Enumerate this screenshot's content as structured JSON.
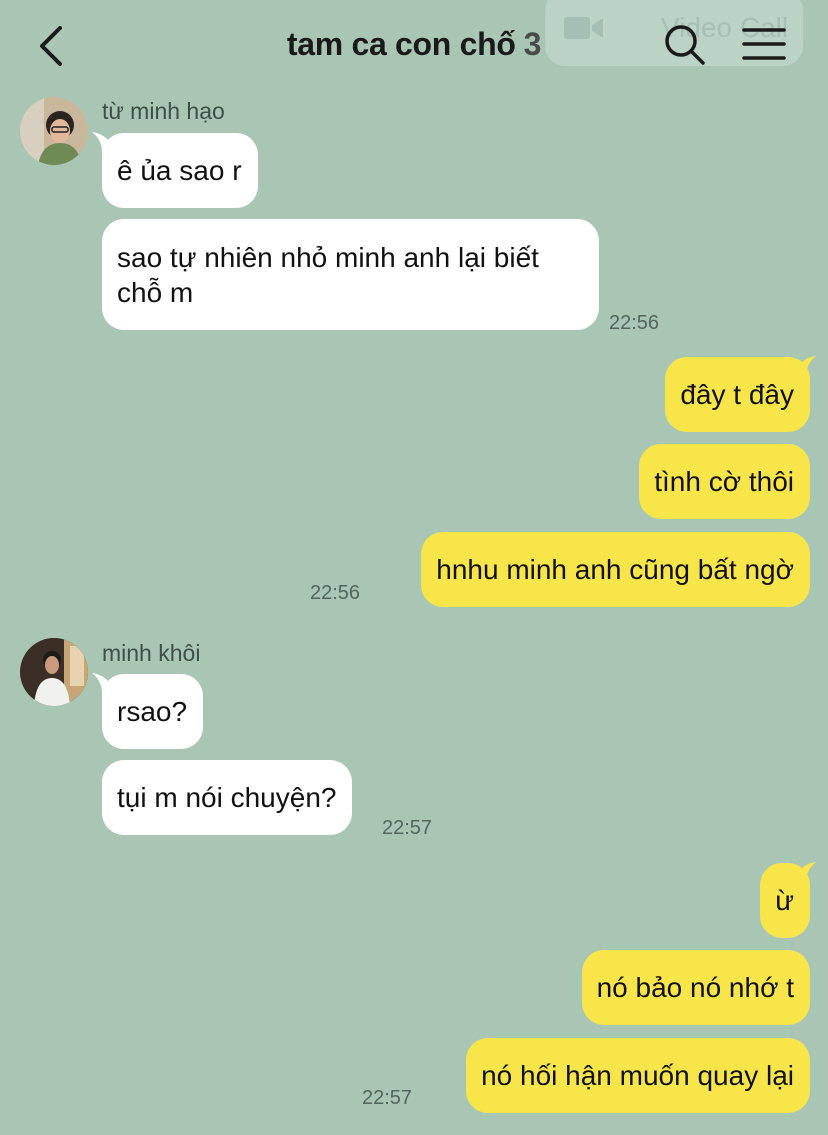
{
  "header": {
    "title": "tam ca con chố",
    "member_count": "3",
    "video_call_label": "Video Call"
  },
  "groups": [
    {
      "sender": "từ minh hạo",
      "messages": [
        "ê ủa sao r",
        "sao tự nhiên nhỏ minh anh lại biết chỗ m"
      ],
      "time": "22:56"
    },
    {
      "sender": "me",
      "messages": [
        "đây t đây",
        "tình cờ thôi",
        "hnhu minh anh cũng bất ngờ"
      ],
      "time": "22:56"
    },
    {
      "sender": "minh khôi",
      "messages": [
        "rsao?",
        "tụi m nói chuyện?"
      ],
      "time": "22:57"
    },
    {
      "sender": "me",
      "messages": [
        "ừ",
        "nó bảo nó nhớ t",
        "nó hối hận muốn quay lại"
      ],
      "time": "22:57"
    }
  ],
  "colors": {
    "background": "#a9c6b5",
    "incoming_bubble": "#ffffff",
    "outgoing_bubble": "#f8e54a"
  }
}
